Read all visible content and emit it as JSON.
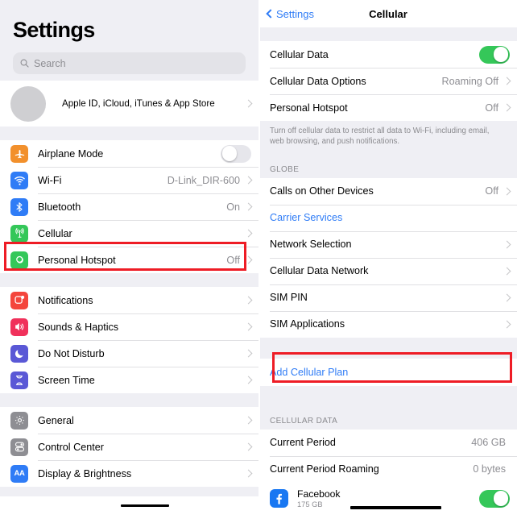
{
  "left": {
    "title": "Settings",
    "search": {
      "placeholder": "Search",
      "icon": "search-icon"
    },
    "profile": {
      "label": "Apple ID, iCloud, iTunes & App Store",
      "icon": "avatar"
    },
    "groups": [
      {
        "items": [
          {
            "label": "Airplane Mode",
            "icon": "airplane-icon",
            "color": "#f2902c",
            "control": "toggle-off"
          },
          {
            "label": "Wi-Fi",
            "icon": "wifi-icon",
            "color": "#2f7cf6",
            "value": "D-Link_DIR-600",
            "control": "chevron"
          },
          {
            "label": "Bluetooth",
            "icon": "bluetooth-icon",
            "color": "#2f7cf6",
            "value": "On",
            "control": "chevron"
          },
          {
            "label": "Cellular",
            "icon": "cellular-icon",
            "color": "#34c759",
            "value": "",
            "control": "chevron",
            "highlighted": true
          },
          {
            "label": "Personal Hotspot",
            "icon": "hotspot-icon",
            "color": "#34c759",
            "value": "Off",
            "control": "chevron"
          }
        ]
      },
      {
        "items": [
          {
            "label": "Notifications",
            "icon": "notifications-icon",
            "color": "#f4453c",
            "control": "chevron"
          },
          {
            "label": "Sounds & Haptics",
            "icon": "sounds-icon",
            "color": "#f0315b",
            "control": "chevron"
          },
          {
            "label": "Do Not Disturb",
            "icon": "moon-icon",
            "color": "#5a58d6",
            "control": "chevron"
          },
          {
            "label": "Screen Time",
            "icon": "hourglass-icon",
            "color": "#5a58d6",
            "control": "chevron"
          }
        ]
      },
      {
        "items": [
          {
            "label": "General",
            "icon": "gear-icon",
            "color": "#8e8e93",
            "control": "chevron"
          },
          {
            "label": "Control Center",
            "icon": "control-center-icon",
            "color": "#8e8e93",
            "control": "chevron"
          },
          {
            "label": "Display & Brightness",
            "icon": "display-icon",
            "color": "#2f7cf6",
            "control": "chevron",
            "redacted": true
          }
        ]
      }
    ]
  },
  "right": {
    "nav": {
      "back_label": "Settings",
      "title": "Cellular",
      "back_icon": "back-chevron-icon"
    },
    "data_group": [
      {
        "label": "Cellular Data",
        "control": "toggle-on"
      },
      {
        "label": "Cellular Data Options",
        "value": "Roaming Off",
        "control": "chevron"
      },
      {
        "label": "Personal Hotspot",
        "value": "Off",
        "control": "chevron"
      }
    ],
    "footnote": "Turn off cellular data to restrict all data to Wi-Fi, including email, web browsing, and push notifications.",
    "carrier_header": "GLOBE",
    "carrier_group": [
      {
        "label": "Calls on Other Devices",
        "value": "Off",
        "control": "chevron"
      },
      {
        "label": "Carrier Services",
        "link": true
      },
      {
        "label": "Network Selection",
        "control": "chevron"
      },
      {
        "label": "Cellular Data Network",
        "control": "chevron"
      },
      {
        "label": "SIM PIN",
        "control": "chevron"
      },
      {
        "label": "SIM Applications",
        "control": "chevron"
      }
    ],
    "add_plan": {
      "label": "Add Cellular Plan",
      "highlighted": true
    },
    "usage_header": "CELLULAR DATA",
    "usage_rows": [
      {
        "label": "Current Period",
        "value": "406 GB"
      },
      {
        "label": "Current Period Roaming",
        "value": "0 bytes"
      }
    ],
    "apps": [
      {
        "name": "Facebook",
        "size": "175 GB",
        "icon": "facebook-icon",
        "control": "toggle-on",
        "redacted": true
      }
    ]
  },
  "colors": {
    "accent": "#2f7cf6",
    "toggle_on": "#35c759",
    "highlight": "#ee1c25",
    "group_bg": "#efeff4"
  }
}
